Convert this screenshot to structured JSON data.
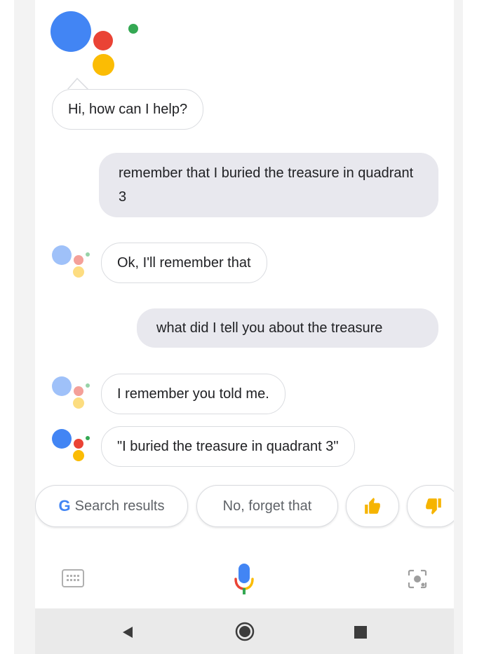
{
  "conversation": {
    "greeting": "Hi, how can I help?",
    "user_message_1": "remember that I buried the treasure in quadrant 3",
    "assistant_reply_1": "Ok, I'll remember that",
    "user_message_2": "what did I tell you about the treasure",
    "assistant_reply_2": "I remember you told me.",
    "assistant_reply_3": "\"I buried the treasure in quadrant 3\""
  },
  "suggestions": {
    "search_results": "Search results",
    "forget": "No, forget that"
  },
  "icons": {
    "google_logo": "G",
    "thumbs_up": "thumbs-up-icon",
    "thumbs_down": "thumbs-down-icon",
    "keyboard": "keyboard-icon",
    "mic": "mic-icon",
    "lens": "lens-icon",
    "back": "back-icon",
    "home": "home-icon",
    "recents": "recents-icon"
  },
  "colors": {
    "blue": "#4285F4",
    "red": "#EA4335",
    "yellow": "#FBBC04",
    "green": "#34A853",
    "user_bubble": "#e8e8ee",
    "chip_border": "#dadce0"
  }
}
